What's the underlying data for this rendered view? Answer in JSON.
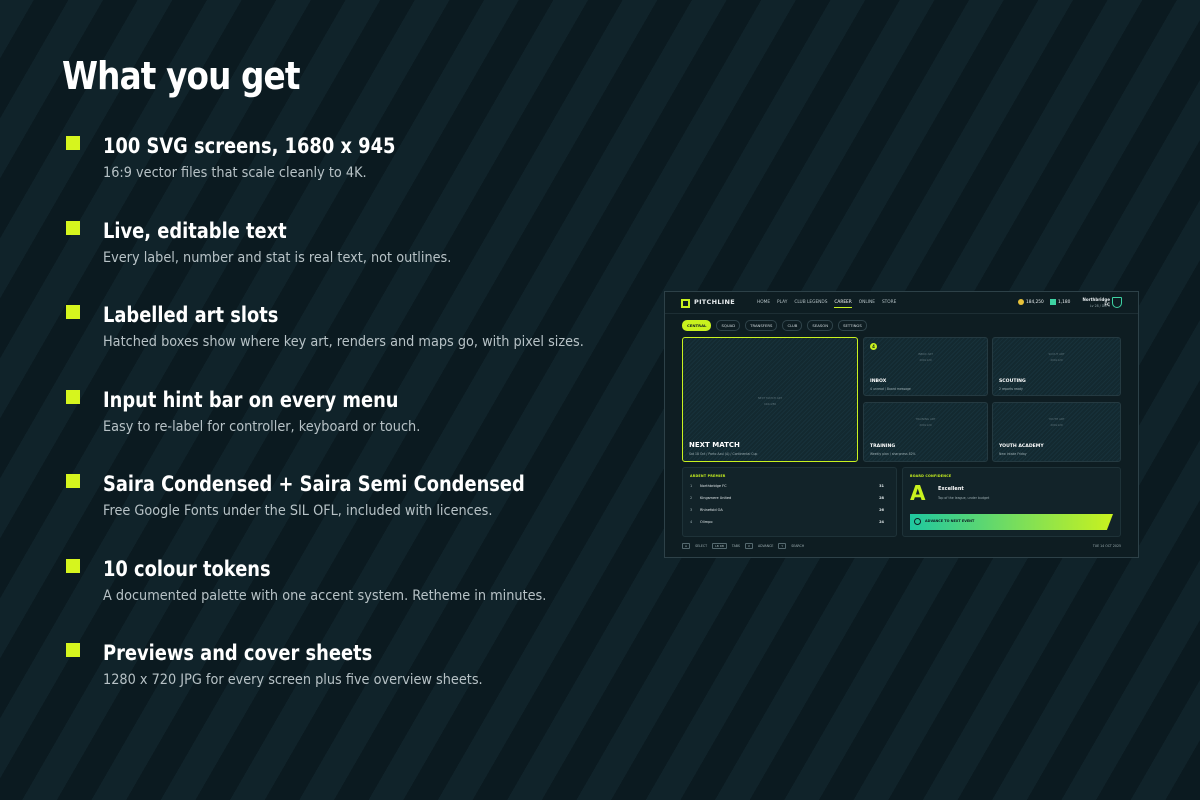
{
  "title": "What you get",
  "accent_color": "#d6f51e",
  "features": [
    {
      "heading": "100 SVG screens, 1680 x 945",
      "description": "16:9 vector files that scale cleanly to 4K."
    },
    {
      "heading": "Live, editable text",
      "description": "Every label, number and stat is real text, not outlines."
    },
    {
      "heading": "Labelled art slots",
      "description": "Hatched boxes show where key art, renders and maps go, with pixel sizes."
    },
    {
      "heading": "Input hint bar on every menu",
      "description": "Easy to re-label for controller, keyboard or touch."
    },
    {
      "heading": "Saira Condensed + Saira Semi Condensed",
      "description": "Free Google Fonts under the SIL OFL, included with licences."
    },
    {
      "heading": "10 colour tokens",
      "description": "A documented palette with one accent system. Retheme in minutes."
    },
    {
      "heading": "Previews and cover sheets",
      "description": "1280 x 720 JPG for every screen plus five overview sheets."
    }
  ],
  "preview": {
    "brand": "PITCHLINE",
    "nav": [
      "HOME",
      "PLAY",
      "CLUB LEGENDS",
      "CAREER",
      "ONLINE",
      "STORE"
    ],
    "nav_active": "CAREER",
    "coins": "184,250",
    "gems": "1,180",
    "club_name": "Northbridge FC",
    "club_sub": "Lv 28 / Div 3",
    "tabs": [
      "CENTRAL",
      "SQUAD",
      "TRANSFERS",
      "CLUB",
      "SEASON",
      "SETTINGS"
    ],
    "tab_active": "CENTRAL",
    "next_match": {
      "slot": "NEXT MATCH ART",
      "slot_size": "416x280",
      "title": "NEXT MATCH",
      "sub": "Sat 18 Oct / Porto Azul (A) / Continental Cup"
    },
    "inbox": {
      "badge": "4",
      "slot": "INBOX ART",
      "slot_size": "200x120",
      "title": "INBOX",
      "sub": "4 unread / Board message"
    },
    "scouting": {
      "slot": "SCOUT ART",
      "slot_size": "200x120",
      "title": "SCOUTING",
      "sub": "2 reports ready"
    },
    "training": {
      "slot": "TRAINING ART",
      "slot_size": "200x120",
      "title": "TRAINING",
      "sub": "Weekly plan / sharpness 82%"
    },
    "youth": {
      "slot": "YOUTH ART",
      "slot_size": "200x120",
      "title": "YOUTH ACADEMY",
      "sub": "New intake Friday"
    },
    "league": {
      "heading": "ARDENT PREMIER",
      "rows": [
        {
          "pos": "1",
          "team": "Northbridge FC",
          "pts": "31"
        },
        {
          "pos": "2",
          "team": "Kingsmere United",
          "pts": "28"
        },
        {
          "pos": "3",
          "team": "Rhinefold OA",
          "pts": "26"
        },
        {
          "pos": "4",
          "team": "Olimpo",
          "pts": "24"
        }
      ]
    },
    "board": {
      "heading": "BOARD CONFIDENCE",
      "grade": "A",
      "title": "Excellent",
      "sub": "Top of the league, under budget",
      "button": "ADVANCE TO NEXT EVENT"
    },
    "footer": [
      {
        "key": "A",
        "label": "SELECT"
      },
      {
        "key": "LB RB",
        "label": "TABS"
      },
      {
        "key": "X",
        "label": "ADVANCE"
      },
      {
        "key": "Y",
        "label": "SEARCH"
      }
    ],
    "date": "TUE 14 OCT 2025"
  }
}
